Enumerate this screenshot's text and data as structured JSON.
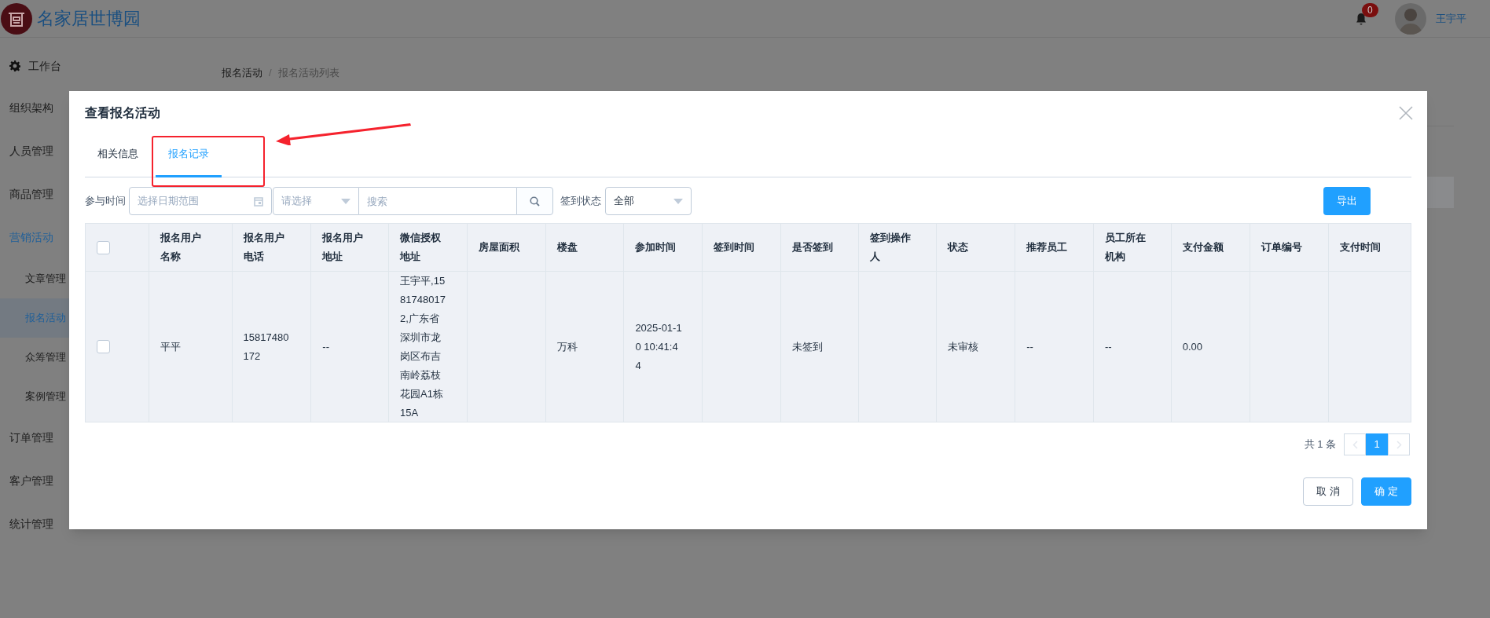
{
  "header": {
    "logo_text": "名家居世博园",
    "notification_count": "0",
    "user_name": "王宇平"
  },
  "sidebar": {
    "items": [
      {
        "label": "工作台",
        "kind": "home",
        "selected": false
      },
      {
        "label": "组织架构",
        "kind": "plain",
        "selected": false
      },
      {
        "label": "人员管理",
        "kind": "plain",
        "selected": false
      },
      {
        "label": "商品管理",
        "kind": "plain",
        "selected": false
      },
      {
        "label": "营销活动",
        "kind": "plain",
        "selected": false,
        "expanded": true,
        "children": [
          {
            "label": "文章管理",
            "selected": false
          },
          {
            "label": "报名活动",
            "selected": true
          },
          {
            "label": "众筹管理",
            "selected": false
          },
          {
            "label": "案例管理",
            "selected": false
          }
        ]
      },
      {
        "label": "订单管理",
        "kind": "plain",
        "selected": false
      },
      {
        "label": "客户管理",
        "kind": "plain",
        "selected": false
      },
      {
        "label": "统计管理",
        "kind": "plain",
        "selected": false
      }
    ]
  },
  "breadcrumb": [
    "报名活动",
    "报名活动列表"
  ],
  "breadcrumb_separator": "/",
  "modal": {
    "title": "查看报名活动",
    "tabs": [
      {
        "label": "相关信息",
        "selected": false
      },
      {
        "label": "报名记录",
        "selected": true
      }
    ],
    "filters": {
      "date_label": "参与时间",
      "date_placeholder": "选择日期范围",
      "select_placeholder": "请选择",
      "search_placeholder": "搜索",
      "status_label": "签到状态",
      "status_value": "全部"
    },
    "export_button": "导出",
    "table": {
      "header_checked": false,
      "columns": [
        "报名用户名称",
        "报名用户电话",
        "报名用户地址",
        "微信授权地址",
        "房屋面积",
        "楼盘",
        "参加时间",
        "签到时间",
        "是否签到",
        "签到操作人",
        "状态",
        "推荐员工",
        "员工所在机构",
        "支付金额",
        "订单编号",
        "支付时间"
      ],
      "rows": [
        {
          "checked": false,
          "cells": [
            "平平",
            "15817480172",
            "--",
            "王宇平,15817480172,广东省深圳市龙岗区布吉南岭荔枝花园A1栋15A",
            "",
            "万科",
            "2025-01-10 10:41:44",
            "",
            "未签到",
            "",
            "未审核",
            "--",
            "--",
            "0.00",
            "",
            ""
          ]
        }
      ]
    },
    "pagination": {
      "total": "共 1 条",
      "pages": [
        {
          "label": "1",
          "selected": true
        }
      ]
    },
    "buttons": [
      {
        "label": "取 消",
        "kind": "secondary"
      },
      {
        "label": "确 定",
        "kind": "primary"
      }
    ]
  }
}
